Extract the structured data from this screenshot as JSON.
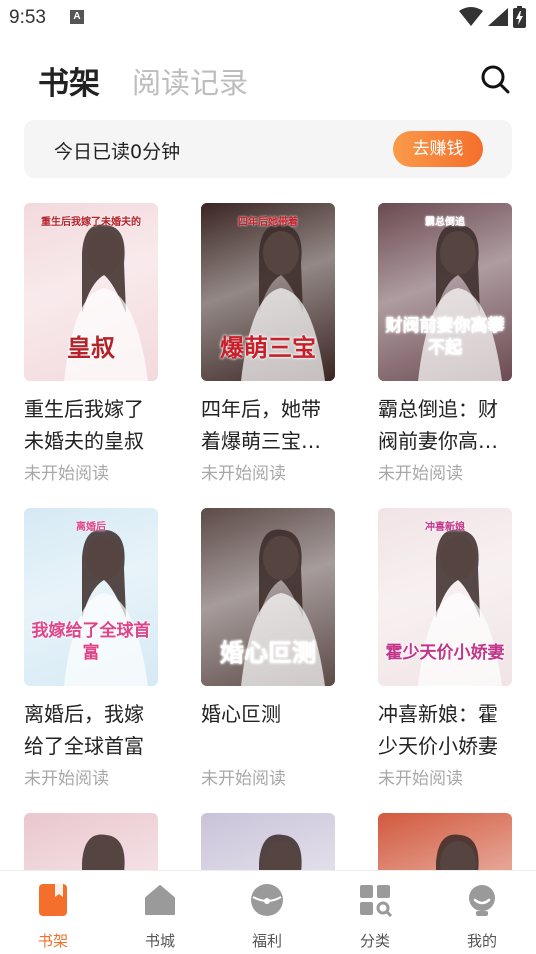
{
  "status_bar": {
    "time": "9:53",
    "notif_letter": "A"
  },
  "header": {
    "tabs": [
      {
        "label": "书架",
        "active": true
      },
      {
        "label": "阅读记录",
        "active": false
      }
    ],
    "search_icon": "search-icon"
  },
  "banner": {
    "text": "今日已读0分钟",
    "button_label": "去赚钱"
  },
  "books": [
    {
      "title": "重生后我嫁了未婚夫的皇叔",
      "status": "未开始阅读",
      "cover_text": "皇叔",
      "cover_sub": "重生后我嫁了未婚夫的",
      "cover_bg": "#f3d9dc",
      "cover_fg": "#b3232a"
    },
    {
      "title": "四年后，她带着爆萌三宝…",
      "status": "未开始阅读",
      "cover_text": "爆萌三宝",
      "cover_sub": "四年后她带着",
      "cover_bg": "#3b2623",
      "cover_fg": "#c8202a"
    },
    {
      "title": "霸总倒追：财阀前妻你高…",
      "status": "未开始阅读",
      "cover_text": "财阀前妻你高攀不起",
      "cover_sub": "霸总倒追",
      "cover_bg": "#6b4a52",
      "cover_fg": "#ffffff"
    },
    {
      "title": "离婚后，我嫁给了全球首富",
      "status": "未开始阅读",
      "cover_text": "我嫁给了全球首富",
      "cover_sub": "离婚后",
      "cover_bg": "#d5eaf4",
      "cover_fg": "#e0458a"
    },
    {
      "title": "婚心叵测",
      "status": "未开始阅读",
      "cover_text": "婚心叵测",
      "cover_sub": "",
      "cover_bg": "#5c4b48",
      "cover_fg": "#ffffff"
    },
    {
      "title": "冲喜新娘：霍少天价小娇妻",
      "status": "未开始阅读",
      "cover_text": "霍少天价小娇妻",
      "cover_sub": "冲喜新娘",
      "cover_bg": "#f1e4e6",
      "cover_fg": "#c2368a"
    },
    {
      "title": "",
      "status": "",
      "cover_text": "",
      "cover_sub": "",
      "cover_bg": "#e9c7cd",
      "cover_fg": "#ffffff"
    },
    {
      "title": "",
      "status": "",
      "cover_text": "",
      "cover_sub": "",
      "cover_bg": "#c9c3d8",
      "cover_fg": "#ffffff"
    },
    {
      "title": "",
      "status": "",
      "cover_text": "",
      "cover_sub": "",
      "cover_bg": "#d25a3e",
      "cover_fg": "#ffffff"
    }
  ],
  "bottom_nav": [
    {
      "label": "书架",
      "icon": "bookshelf-icon",
      "active": true
    },
    {
      "label": "书城",
      "icon": "home-icon",
      "active": false
    },
    {
      "label": "福利",
      "icon": "gift-icon",
      "active": false
    },
    {
      "label": "分类",
      "icon": "category-icon",
      "active": false
    },
    {
      "label": "我的",
      "icon": "profile-icon",
      "active": false
    }
  ],
  "colors": {
    "accent": "#f46f2b",
    "inactive_tab": "#bdbdbd",
    "status_text": "#a8a8a8"
  }
}
